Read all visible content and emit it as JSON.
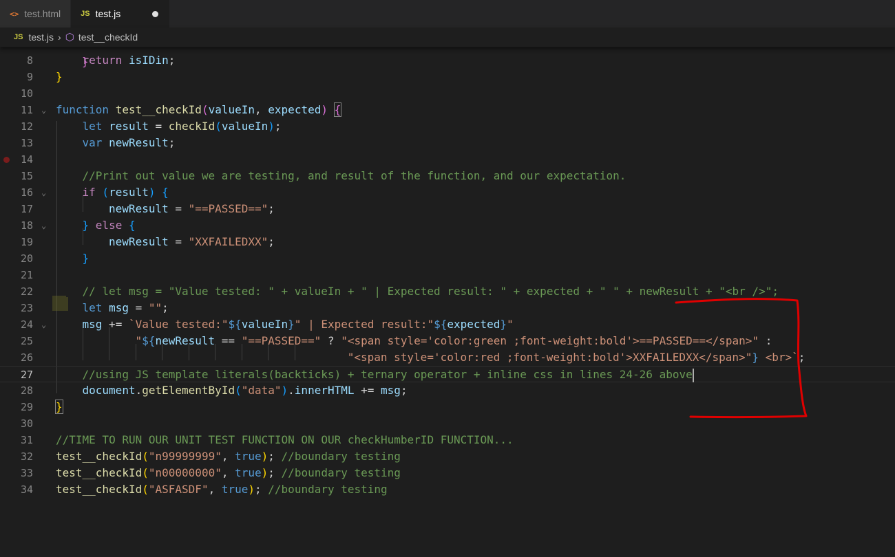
{
  "tabs": [
    {
      "label": "test.html",
      "icon": "html-file-icon",
      "active": false
    },
    {
      "label": "test.js",
      "icon": "js-file-icon",
      "active": true,
      "unsaved": true
    }
  ],
  "breadcrumb": {
    "file": "test.js",
    "symbol": "test__checkId"
  },
  "lines": [
    {
      "n": "8",
      "code": "return isIDin;"
    },
    {
      "n": "9",
      "code": "}"
    },
    {
      "n": "10",
      "code": ""
    },
    {
      "n": "11",
      "code": "function test__checkId(valueIn, expected) {"
    },
    {
      "n": "12",
      "code": "let result = checkId(valueIn);"
    },
    {
      "n": "13",
      "code": "var newResult;"
    },
    {
      "n": "14",
      "code": ""
    },
    {
      "n": "15",
      "code": "//Print out value we are testing, and result of the function, and our expectation."
    },
    {
      "n": "16",
      "code": "if (result) {"
    },
    {
      "n": "17",
      "code": "newResult = \"==PASSED==\";"
    },
    {
      "n": "18",
      "code": "} else {"
    },
    {
      "n": "19",
      "code": "newResult = \"XXFAILEDXX\";"
    },
    {
      "n": "20",
      "code": "}"
    },
    {
      "n": "21",
      "code": ""
    },
    {
      "n": "22",
      "code": "// let msg = \"Value tested: \" + valueIn + \" | Expected result: \" + expected + \" \" + newResult + \"<br />\";"
    },
    {
      "n": "23",
      "code": "let msg = \"\";"
    },
    {
      "n": "24",
      "code": "msg += `Value tested:\"${valueIn}\" | Expected result:\"${expected}\""
    },
    {
      "n": "25",
      "code": "\"${newResult == \"==PASSED==\" ? \"<span style='color:green ;font-weight:bold'>==PASSED==</span>\" :"
    },
    {
      "n": "26",
      "code": "\"<span style='color:red ;font-weight:bold'>XXFAILEDXX</span>\"} <br>`;"
    },
    {
      "n": "27",
      "code": "//using JS template literals(backticks) + ternary operator + inline css in lines 24-26 above"
    },
    {
      "n": "28",
      "code": "document.getElementById(\"data\").innerHTML += msg;"
    },
    {
      "n": "29",
      "code": "}"
    },
    {
      "n": "30",
      "code": ""
    },
    {
      "n": "31",
      "code": "//TIME TO RUN OUR UNIT TEST FUNCTION ON OUR checkHumberID FUNCTION..."
    },
    {
      "n": "32",
      "code": "test__checkId(\"n99999999\", true); //boundary testing"
    },
    {
      "n": "33",
      "code": "test__checkId(\"n00000000\", true); //boundary testing"
    },
    {
      "n": "34",
      "code": "test__checkId(\"ASFASDF\", true); //boundary testing"
    }
  ],
  "current_line": "27",
  "breakpoint_line": "14",
  "annotation_color": "#e00000"
}
